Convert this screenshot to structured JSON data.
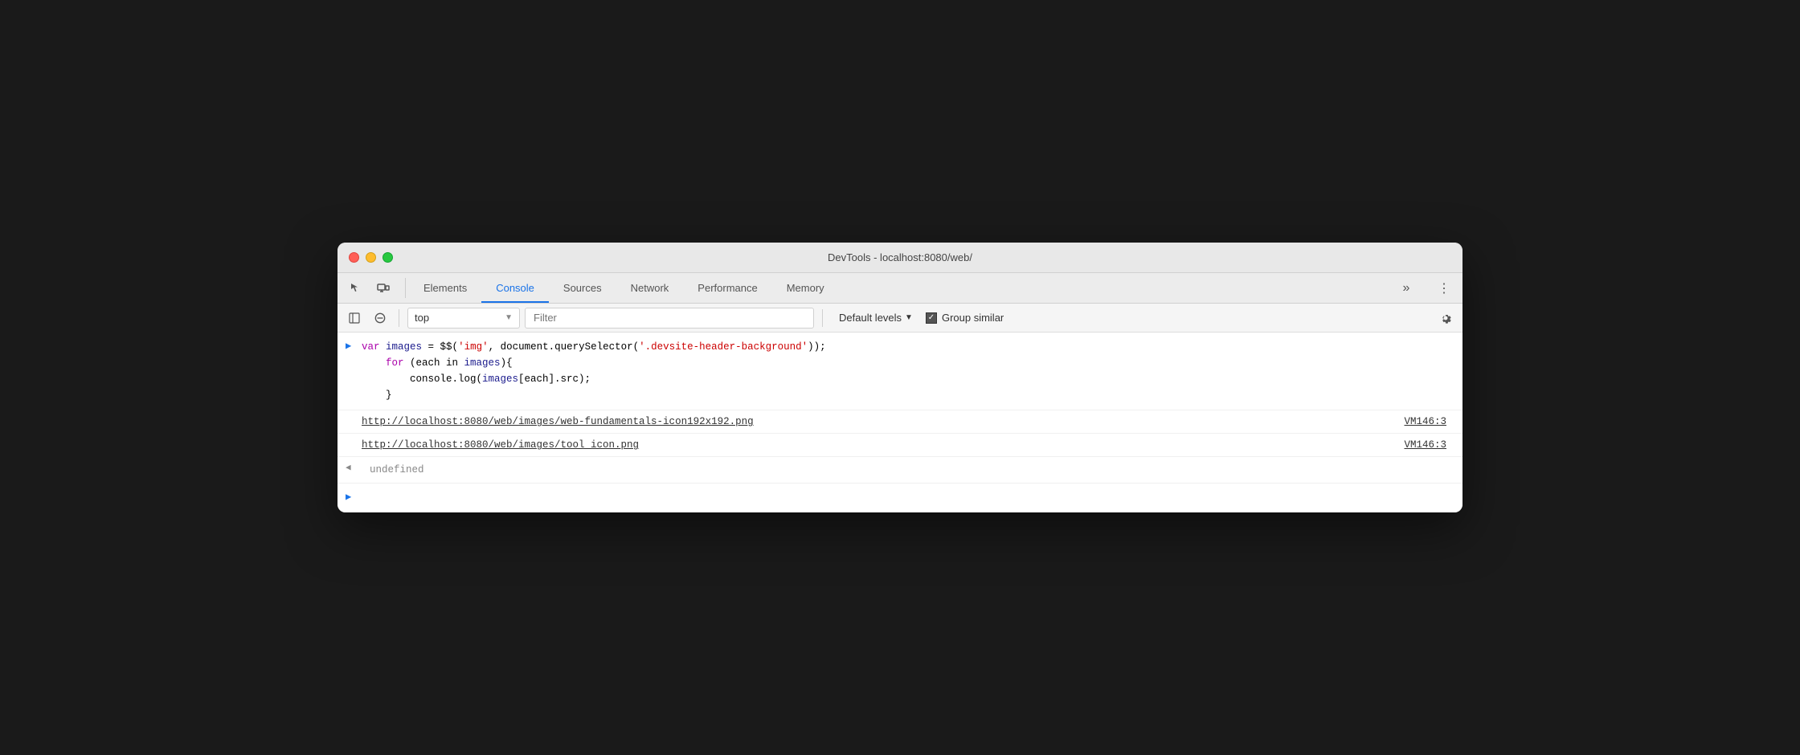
{
  "window": {
    "title": "DevTools - localhost:8080/web/",
    "traffic_lights": [
      "red",
      "yellow",
      "green"
    ]
  },
  "tabs": {
    "items": [
      {
        "id": "elements",
        "label": "Elements",
        "active": false
      },
      {
        "id": "console",
        "label": "Console",
        "active": true
      },
      {
        "id": "sources",
        "label": "Sources",
        "active": false
      },
      {
        "id": "network",
        "label": "Network",
        "active": false
      },
      {
        "id": "performance",
        "label": "Performance",
        "active": false
      },
      {
        "id": "memory",
        "label": "Memory",
        "active": false
      }
    ],
    "more_label": "»",
    "menu_label": "⋮"
  },
  "toolbar": {
    "context": "top",
    "context_arrow": "▼",
    "filter_placeholder": "Filter",
    "levels_label": "Default levels",
    "levels_arrow": "▼",
    "group_similar_label": "Group similar"
  },
  "console": {
    "input_line1": "var images = $$('img', document.querySelector('.devsite-header-background'));",
    "input_line2": "    for (each in images){",
    "input_line3": "        console.log(images[each].src);",
    "input_line4": "    }",
    "link1": "http://localhost:8080/web/images/web-fundamentals-icon192x192.png",
    "link1_source": "VM146:3",
    "link2": "http://localhost:8080/web/images/tool_icon.png",
    "link2_source": "VM146:3",
    "undefined_text": "undefined"
  }
}
